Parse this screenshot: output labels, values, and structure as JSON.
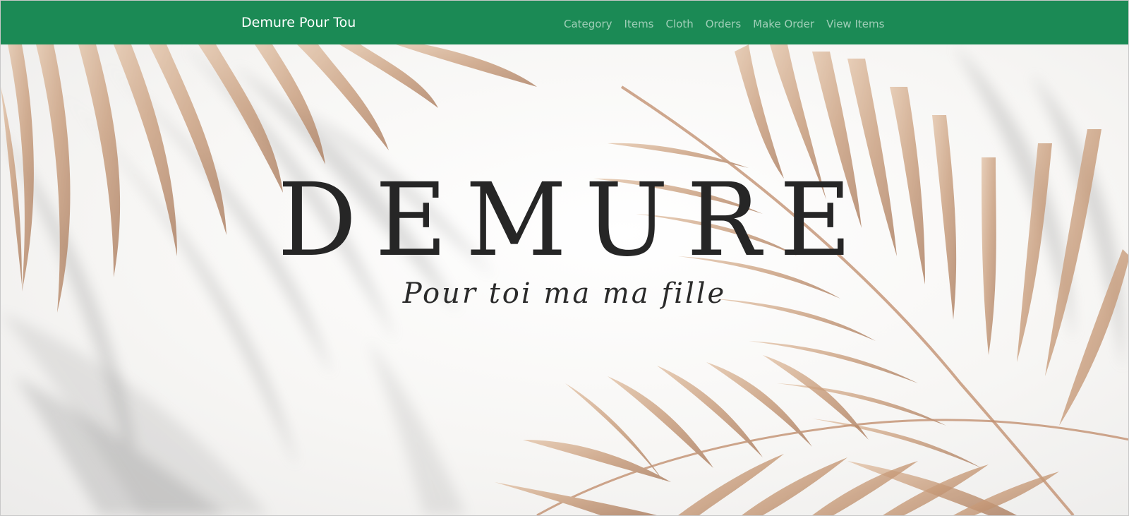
{
  "navbar": {
    "brand": "Demure Pour Tou",
    "links": [
      "Category",
      "Items",
      "Cloth",
      "Orders",
      "Make Order",
      "View Items"
    ],
    "background_color": "#1b8a55"
  },
  "hero": {
    "title": "DEMURE",
    "tagline": "Pour toi ma ma fille",
    "leaf_color": "#c79a78",
    "shadow_color": "#9a9a9a"
  }
}
